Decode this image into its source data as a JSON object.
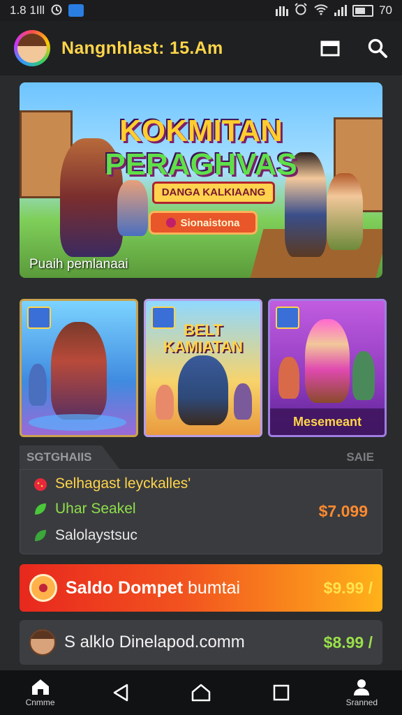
{
  "status_bar": {
    "left_text": "1.8 1Ill",
    "right_text": "70"
  },
  "header": {
    "title": "Nangnhlast: 15.Am"
  },
  "hero": {
    "title_line1": "KOKMITAN",
    "title_line2": "PERAGHVAS",
    "subtitle": "DANGA KALKIAANG",
    "button_label": "Sionaistona",
    "caption": "Puaih pemlanaai"
  },
  "game_cards": [
    {
      "label": ""
    },
    {
      "headline": "BELT\nKAMIATAN",
      "label": ""
    },
    {
      "label": "Mesemeant"
    }
  ],
  "section": {
    "left_tab": "SGTGHAIIS",
    "right_label": "SAIE"
  },
  "list": {
    "rows": [
      {
        "label": "Selhagast leyckalles'"
      },
      {
        "label": "Uhar Seakel"
      },
      {
        "label": "Salolaystsuc"
      }
    ],
    "price": "$7.099"
  },
  "wallet_primary": {
    "label_bold": "Saldo Dompet",
    "label_rest": "bumtai",
    "price": "$9.99 /"
  },
  "wallet_secondary": {
    "label": "S alklo Dinelapod.comm",
    "price": "$8.99 /"
  },
  "bottom_nav": {
    "home_label": "Cnmme",
    "profile_label": "Sranned"
  },
  "colors": {
    "title_yellow": "#ffd54a",
    "price_orange": "#ff8a2e",
    "price_green": "#9ae04a",
    "wallet_gradient_start": "#e8281e",
    "wallet_gradient_end": "#ffb21a"
  }
}
